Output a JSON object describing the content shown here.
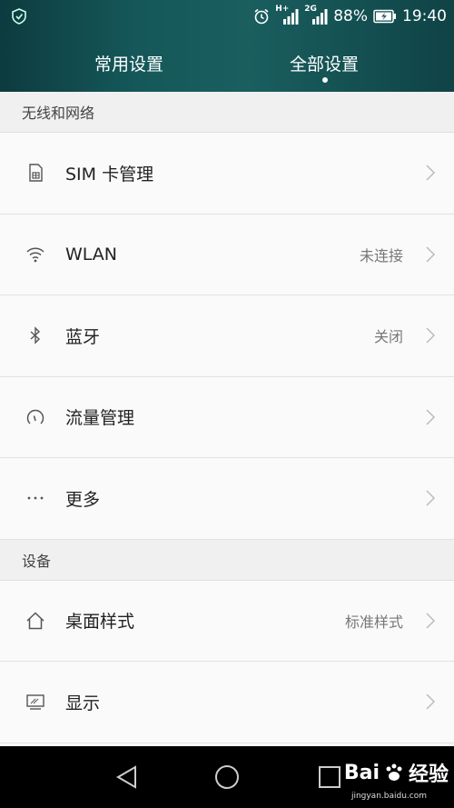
{
  "status_bar": {
    "network_type": "H+",
    "network_type2": "2G",
    "battery": "88%",
    "time": "19:40"
  },
  "tabs": [
    {
      "label": "常用设置",
      "active": false
    },
    {
      "label": "全部设置",
      "active": true
    }
  ],
  "sections": {
    "wireless": {
      "title": "无线和网络",
      "items": [
        {
          "label": "SIM 卡管理",
          "value": "",
          "icon": "sim-card-icon"
        },
        {
          "label": "WLAN",
          "value": "未连接",
          "icon": "wifi-icon"
        },
        {
          "label": "蓝牙",
          "value": "关闭",
          "icon": "bluetooth-icon"
        },
        {
          "label": "流量管理",
          "value": "",
          "icon": "data-usage-icon"
        },
        {
          "label": "更多",
          "value": "",
          "icon": "more-icon"
        }
      ]
    },
    "device": {
      "title": "设备",
      "items": [
        {
          "label": "桌面样式",
          "value": "标准样式",
          "icon": "home-icon"
        },
        {
          "label": "显示",
          "value": "",
          "icon": "display-icon"
        }
      ]
    }
  },
  "watermark": {
    "text_bai": "Bai",
    "text_du": "经验",
    "url": "jingyan.baidu.com"
  }
}
